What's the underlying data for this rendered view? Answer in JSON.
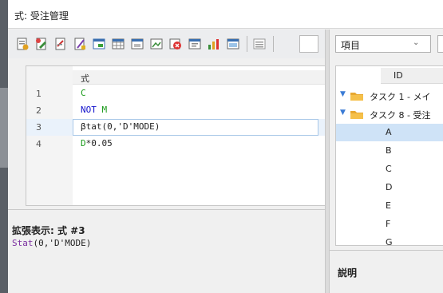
{
  "window": {
    "title": "式: 受注管理"
  },
  "toolbar": {
    "icons": [
      "document-properties-icon",
      "document-edit-icon",
      "document-add-icon",
      "document-check-icon",
      "table-icon",
      "table-grid-icon",
      "sheet-icon",
      "image-icon",
      "delete-icon",
      "copy-icon",
      "chart-icon",
      "view-icon",
      "list-icon"
    ]
  },
  "editor": {
    "column_header": "式",
    "lines": [
      {
        "num": "1",
        "parts": [
          "C"
        ]
      },
      {
        "num": "2",
        "parts": [
          "NOT ",
          "M"
        ]
      },
      {
        "num": "3",
        "parts": [
          "βtat",
          "(0,'D'MODE)"
        ]
      },
      {
        "num": "4",
        "parts": [
          "D",
          "*0.05"
        ]
      }
    ],
    "current_line": 3
  },
  "detail": {
    "label": "拡張表示: 式 #3",
    "expr_func": "Stat",
    "expr_args": "(0,'D'MODE)"
  },
  "right": {
    "combo_value": "項目",
    "tree_header": "ID",
    "rows": [
      {
        "type": "task",
        "label": "タスク 1 - メイ"
      },
      {
        "type": "task",
        "label": "タスク 8 - 受注"
      },
      {
        "type": "leaf",
        "label": "A",
        "selected": true
      },
      {
        "type": "leaf",
        "label": "B"
      },
      {
        "type": "leaf",
        "label": "C"
      },
      {
        "type": "leaf",
        "label": "D"
      },
      {
        "type": "leaf",
        "label": "E"
      },
      {
        "type": "leaf",
        "label": "F"
      },
      {
        "type": "leaf",
        "label": "G"
      }
    ],
    "desc_label": "説明"
  },
  "colors": {
    "accent": "#3a7bd5",
    "code_green": "#1a9a1a",
    "code_blue": "#1111cc",
    "selection": "#cfe3f7"
  }
}
